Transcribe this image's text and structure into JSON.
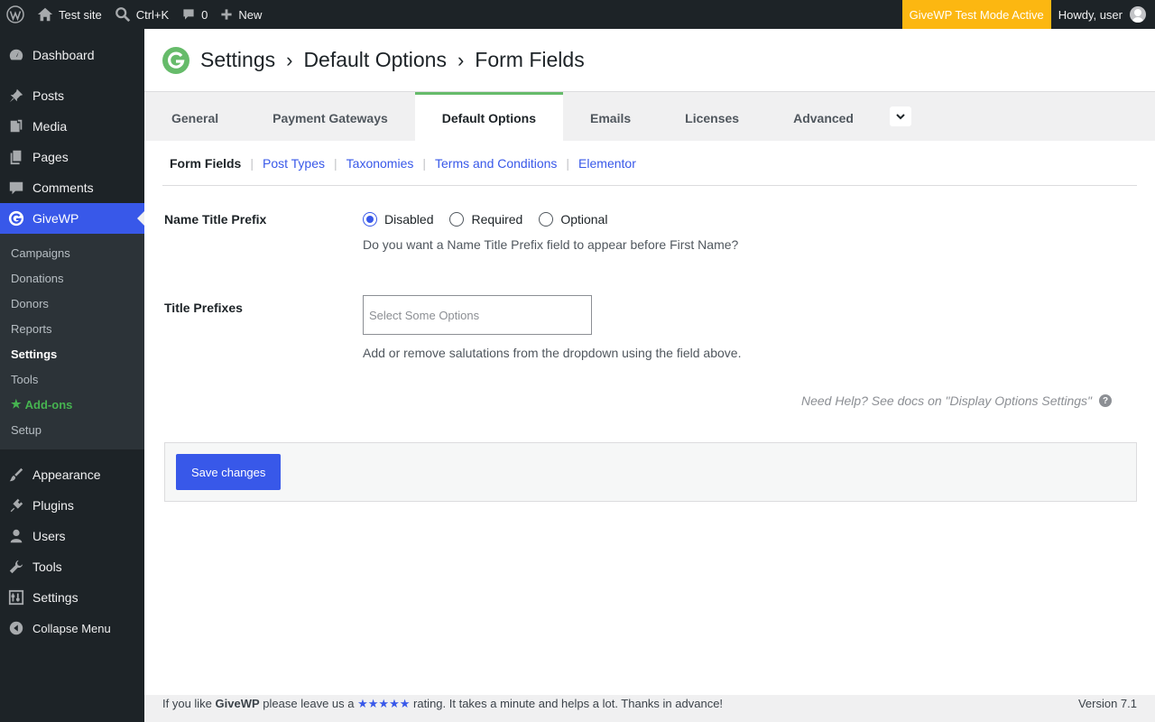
{
  "adminbar": {
    "site": "Test site",
    "search": "Ctrl+K",
    "comments_count": "0",
    "new": "New",
    "test_mode": "GiveWP Test Mode Active",
    "howdy": "Howdy, user"
  },
  "sidebar": {
    "top": [
      {
        "label": "Dashboard",
        "icon": "dashboard-icon"
      },
      {
        "label": "Posts",
        "icon": "pin-icon"
      },
      {
        "label": "Media",
        "icon": "media-icon"
      },
      {
        "label": "Pages",
        "icon": "pages-icon"
      },
      {
        "label": "Comments",
        "icon": "comment-icon"
      }
    ],
    "current": "GiveWP",
    "submenu": [
      "Campaigns",
      "Donations",
      "Donors",
      "Reports",
      "Settings",
      "Tools",
      "Add-ons",
      "Setup"
    ],
    "bottom": [
      {
        "label": "Appearance",
        "icon": "brush-icon"
      },
      {
        "label": "Plugins",
        "icon": "plug-icon"
      },
      {
        "label": "Users",
        "icon": "user-icon"
      },
      {
        "label": "Tools",
        "icon": "wrench-icon"
      },
      {
        "label": "Settings",
        "icon": "settings-icon"
      }
    ],
    "collapse": "Collapse Menu"
  },
  "header": {
    "crumbs": [
      "Settings",
      "Default Options",
      "Form Fields"
    ],
    "separator": "›"
  },
  "tabs": [
    "General",
    "Payment Gateways",
    "Default Options",
    "Emails",
    "Licenses",
    "Advanced"
  ],
  "subnav": [
    "Form Fields",
    "Post Types",
    "Taxonomies",
    "Terms and Conditions",
    "Elementor"
  ],
  "fields": {
    "prefix_label": "Name Title Prefix",
    "prefix_options": [
      "Disabled",
      "Required",
      "Optional"
    ],
    "prefix_selected": "Disabled",
    "prefix_desc": "Do you want a Name Title Prefix field to appear before First Name?",
    "titles_label": "Title Prefixes",
    "titles_placeholder": "Select Some Options",
    "titles_desc": "Add or remove salutations from the dropdown using the field above."
  },
  "help": "Need Help? See docs on \"Display Options Settings\"",
  "save": "Save changes",
  "footer": {
    "pre": "If you like",
    "brand": "GiveWP",
    "mid": "please leave us a",
    "stars": "★★★★★",
    "post": "rating. It takes a minute and helps a lot. Thanks in advance!",
    "version": "Version 7.1"
  },
  "colors": {
    "accent": "#3858e9",
    "testmode": "#fcb711",
    "tab_active": "#66bb6a"
  }
}
